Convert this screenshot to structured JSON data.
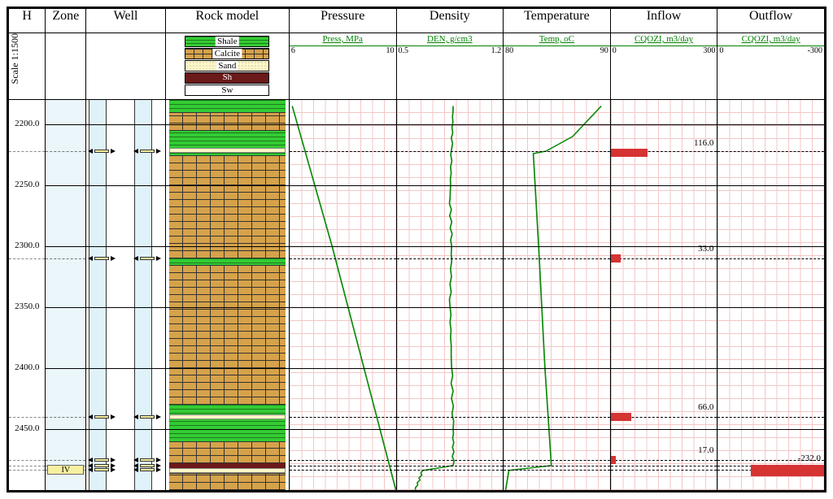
{
  "columns": {
    "h": "H",
    "zone": "Zone",
    "well": "Well",
    "rock": "Rock model",
    "pressure": "Pressure",
    "density": "Density",
    "temperature": "Temperature",
    "inflow": "Inflow",
    "outflow": "Outflow"
  },
  "scale_label": "Scale 1:1500",
  "legend": {
    "shale": "Shale",
    "calcite": "Calcite",
    "sand": "Sand",
    "sh": "Sh",
    "sw": "Sw"
  },
  "tracks": {
    "pressure": {
      "label": "Press, MPa",
      "min": "6",
      "max": "10"
    },
    "density": {
      "label": "DEN, g/cm3",
      "min": "0.5",
      "max": "1.2"
    },
    "temperature": {
      "label": "Temp, oC",
      "min": "80",
      "max": "90"
    },
    "inflow": {
      "label": "CQOZI, m3/day",
      "min": "0",
      "max": "300"
    },
    "outflow": {
      "label": "CQOZI, m3/day",
      "min": "0",
      "max": "-300"
    }
  },
  "depth": {
    "min": 2180,
    "max": 2500,
    "ticks": [
      2200,
      2250,
      2300,
      2350,
      2400,
      2450
    ]
  },
  "zones": {
    "markers": [
      2222,
      2310,
      2440,
      2475,
      2480,
      2483
    ],
    "label": {
      "text": "IV",
      "depth": 2483
    }
  },
  "inflow_bars": [
    {
      "depth": 2223,
      "value": 116.0
    },
    {
      "depth": 2310,
      "value": 33.0
    },
    {
      "depth": 2440,
      "value": 66.0
    },
    {
      "depth": 2475,
      "value": 17.0
    }
  ],
  "outflow_bars": [
    {
      "depth": 2483,
      "value": -232.0
    }
  ],
  "chart_data": {
    "type": "log",
    "depth_range": [
      2180,
      2500
    ],
    "tracks": [
      {
        "name": "Pressure",
        "unit": "MPa",
        "range": [
          6,
          10
        ],
        "points": [
          [
            2185,
            6.1
          ],
          [
            2300,
            7.6
          ],
          [
            2400,
            8.8
          ],
          [
            2500,
            10.0
          ]
        ]
      },
      {
        "name": "Density",
        "unit": "g/cm3",
        "range": [
          0.5,
          1.2
        ],
        "points": [
          [
            2185,
            0.87
          ],
          [
            2220,
            0.86
          ],
          [
            2260,
            0.85
          ],
          [
            2300,
            0.86
          ],
          [
            2350,
            0.85
          ],
          [
            2400,
            0.86
          ],
          [
            2450,
            0.87
          ],
          [
            2480,
            0.87
          ],
          [
            2484,
            0.67
          ],
          [
            2500,
            0.62
          ]
        ]
      },
      {
        "name": "Temperature",
        "unit": "oC",
        "range": [
          80,
          90
        ],
        "points": [
          [
            2185,
            89.2
          ],
          [
            2210,
            86.5
          ],
          [
            2222,
            84.0
          ],
          [
            2224,
            82.8
          ],
          [
            2300,
            83.3
          ],
          [
            2400,
            83.9
          ],
          [
            2480,
            84.5
          ],
          [
            2484,
            80.5
          ],
          [
            2500,
            80.2
          ]
        ]
      },
      {
        "name": "Inflow",
        "unit": "m3/day",
        "range": [
          0,
          300
        ],
        "bars": [
          {
            "depth": 2223,
            "value": 116.0
          },
          {
            "depth": 2310,
            "value": 33.0
          },
          {
            "depth": 2440,
            "value": 66.0
          },
          {
            "depth": 2475,
            "value": 17.0
          }
        ]
      },
      {
        "name": "Outflow",
        "unit": "m3/day",
        "range": [
          0,
          -300
        ],
        "bars": [
          {
            "depth": 2483,
            "value": -232.0
          }
        ]
      }
    ],
    "zones": [
      {
        "name": "IV",
        "depth": 2483
      }
    ],
    "lithology": [
      {
        "type": "shale",
        "from": 2180,
        "to": 2210
      },
      {
        "type": "calcite",
        "from": 2190,
        "to": 2205
      },
      {
        "type": "shale",
        "from": 2205,
        "to": 2222
      },
      {
        "type": "sand",
        "from": 2219,
        "to": 2223
      },
      {
        "type": "calcite",
        "from": 2225,
        "to": 2310
      },
      {
        "type": "calcite",
        "from": 2315,
        "to": 2430
      },
      {
        "type": "shale",
        "from": 2430,
        "to": 2460
      },
      {
        "type": "sand",
        "from": 2438,
        "to": 2442
      },
      {
        "type": "calcite",
        "from": 2460,
        "to": 2478
      },
      {
        "type": "sh",
        "from": 2478,
        "to": 2482
      },
      {
        "type": "sand",
        "from": 2482,
        "to": 2486
      },
      {
        "type": "calcite",
        "from": 2486,
        "to": 2500
      }
    ]
  }
}
